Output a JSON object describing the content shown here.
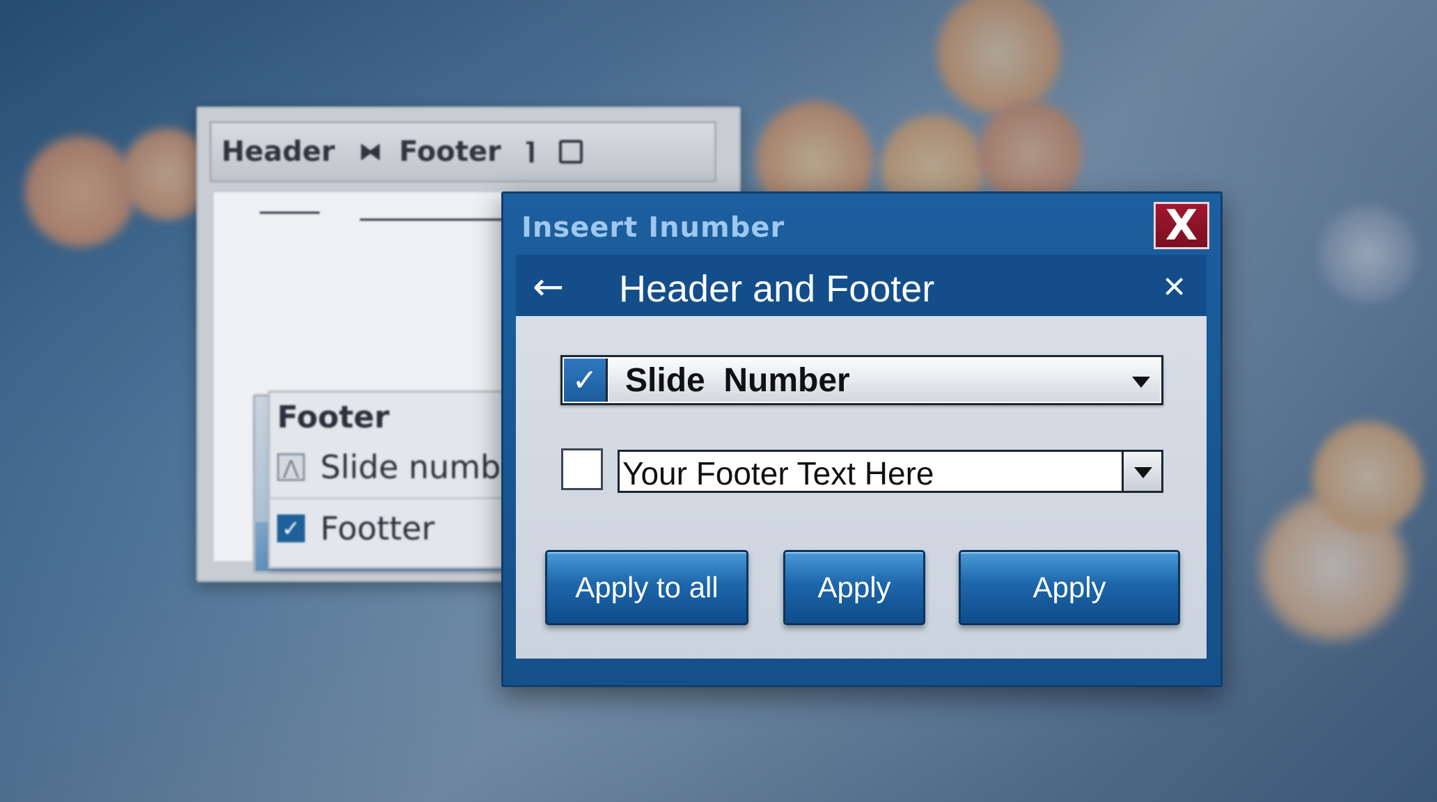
{
  "background": {
    "bokeh_colors": [
      "#f6c787",
      "#e9a878",
      "#fde4c0",
      "#f2b480"
    ]
  },
  "back_window": {
    "toolbar": {
      "header_label": "Header",
      "footer_label": "Footer"
    },
    "popup": {
      "title": "Footer",
      "items": [
        {
          "label": "Slide number",
          "checked": false
        },
        {
          "label": "Footter",
          "checked": true
        }
      ]
    }
  },
  "dialog": {
    "window_title": "Inseert Inumber",
    "close_glyph": "X",
    "header_title": "Header and Footer",
    "back_glyph": "←",
    "close_x_glyph": "×",
    "rows": [
      {
        "checked": true,
        "value": "Slide  Number"
      },
      {
        "checked": false,
        "value": "Your Footer Text Here"
      }
    ],
    "buttons": [
      {
        "label": "Apply to all"
      },
      {
        "label": "Apply"
      },
      {
        "label": "Apply"
      }
    ],
    "colors": {
      "accent": "#1c5f9e",
      "close_red": "#8b1228"
    }
  }
}
